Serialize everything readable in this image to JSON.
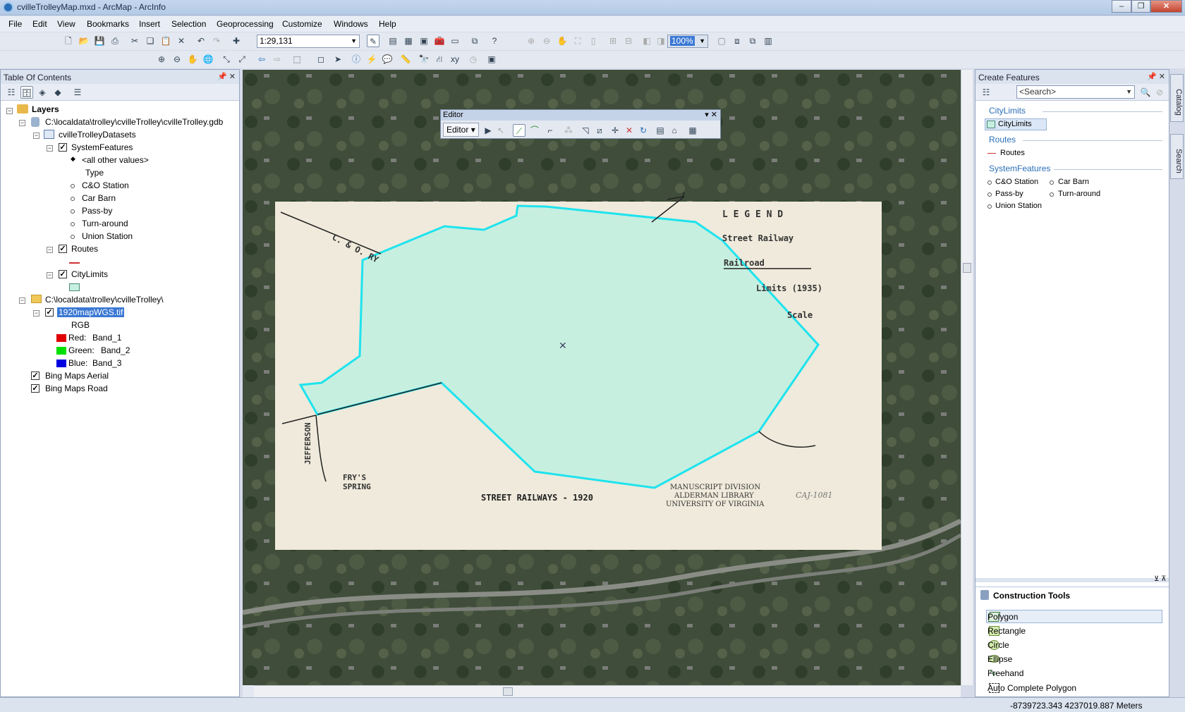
{
  "window": {
    "title": "cvilleTrolleyMap.mxd - ArcMap - ArcInfo"
  },
  "menu": [
    "File",
    "Edit",
    "View",
    "Bookmarks",
    "Insert",
    "Selection",
    "Geoprocessing",
    "Customize",
    "Windows",
    "Help"
  ],
  "toolbar": {
    "scale": "1:29,131",
    "zoom": "100%"
  },
  "toc": {
    "title": "Table Of Contents",
    "layers_root": "Layers",
    "gdb_path": "C:\\localdata\\trolley\\cvilleTrolley\\cvilleTrolley.gdb",
    "dataset": "cvilleTrolleyDatasets",
    "system_features": "SystemFeatures",
    "sf_values": [
      "<all other values>",
      "Type",
      "C&O Station",
      "Car Barn",
      "Pass-by",
      "Turn-around",
      "Union Station"
    ],
    "routes": "Routes",
    "city_limits": "CityLimits",
    "folder_path": "C:\\localdata\\trolley\\cvilleTrolley\\",
    "raster": "1920mapWGS.tif",
    "rgb": "RGB",
    "bands": [
      {
        "label": "Red:",
        "band": "Band_1",
        "color": "#e00000"
      },
      {
        "label": "Green:",
        "band": "Band_2",
        "color": "#00e000"
      },
      {
        "label": "Blue:",
        "band": "Band_3",
        "color": "#0000e0"
      }
    ],
    "basemaps": [
      "Bing Maps Aerial",
      "Bing Maps Road"
    ]
  },
  "editor": {
    "title": "Editor",
    "menu": "Editor"
  },
  "map_text": {
    "legend": "L E G E N D",
    "street_railway": "Street Railway",
    "railroad": "Railroad",
    "limits": "Limits (1935)",
    "scale": "Scale",
    "co_ry": "C. & O. RY",
    "jefferson": "JEFFERSON",
    "frys1": "FRY'S",
    "frys2": "SPRING",
    "street_railways": "STREET RAILWAYS - 1920",
    "ms1": "MANUSCRIPT  DIVISION",
    "ms2": "ALDERMAN LIBRARY",
    "ms3": "UNIVERSITY OF VIRGINIA",
    "catalog_no": "CAJ-1081"
  },
  "create_features": {
    "title": "Create Features",
    "search_placeholder": "<Search>",
    "sections": [
      {
        "name": "CityLimits",
        "items": [
          "CityLimits"
        ]
      },
      {
        "name": "Routes",
        "items": [
          "Routes"
        ]
      },
      {
        "name": "SystemFeatures",
        "items": [
          "C&O Station",
          "Car Barn",
          "Pass-by",
          "Turn-around",
          "Union Station"
        ]
      }
    ]
  },
  "construction_tools": {
    "title": "Construction Tools",
    "items": [
      "Polygon",
      "Rectangle",
      "Circle",
      "Ellipse",
      "Freehand",
      "Auto Complete Polygon"
    ]
  },
  "side_tabs": [
    "Catalog",
    "Search"
  ],
  "status": {
    "coords": "-8739723.343  4237019.887 Meters"
  },
  "colors": {
    "polygon_fill": "#c7efe0",
    "polygon_outline": "#1ee3ee",
    "accent": "#2a6fb6"
  }
}
